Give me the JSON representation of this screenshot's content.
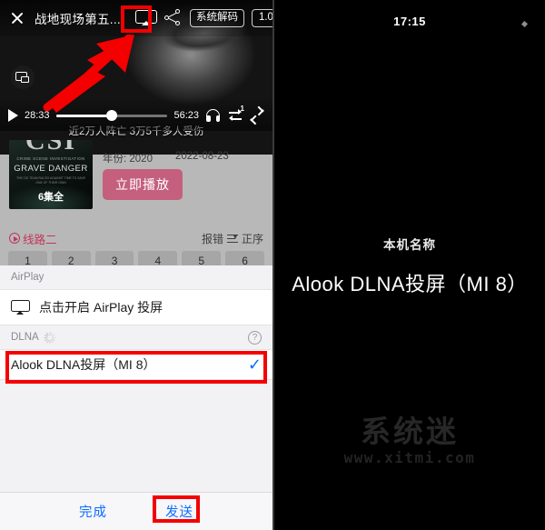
{
  "player": {
    "title": "战地现场第五...",
    "close_icon": "close-icon",
    "cast_icon": "cast-screen-icon",
    "share_icon": "share-icon",
    "decoder_label": "系统解码",
    "speed_label": "1.0",
    "pip_icon": "picture-in-picture-icon",
    "subtitle_text": "近2万人阵亡 3万5千多人受伤",
    "current_time": "28:33",
    "duration": "56:23",
    "play_icon": "play-icon",
    "headphone_icon": "headphone-icon",
    "repeat_icon": "repeat-one-icon",
    "fullscreen_icon": "fullscreen-expand-icon",
    "progress_percent": 50
  },
  "info": {
    "poster_title": "CSI",
    "poster_sub": "CRIME SCENE INVESTIGATION",
    "poster_name": "GRAVE DANGER",
    "poster_fine": "THE CSI TEAM RACES AGAINST TIME TO SAVE ONE OF THEIR OWN",
    "poster_badge": "6集全",
    "year": "年份: 2020",
    "date": "2022-08-23",
    "play_now_label": "立即播放"
  },
  "source": {
    "name": "线路二",
    "play_circle_icon": "play-circle-icon",
    "report_label": "报错",
    "sort_icon": "sort-icon",
    "order_label": "正序",
    "episodes": [
      "1",
      "2",
      "3",
      "4",
      "5",
      "6"
    ]
  },
  "airplay": {
    "section_label": "AirPlay",
    "row_icon": "airplay-screen-icon",
    "row_label": "点击开启 AirPlay 投屏"
  },
  "dlna": {
    "section_label": "DLNA",
    "spinner_icon": "loading-spinner-icon",
    "help_icon": "help-question-icon",
    "help_glyph": "?",
    "device_label": "Alook DLNA投屏（MI 8）",
    "selected_icon": "checkmark-icon",
    "selected_glyph": "✓"
  },
  "footer": {
    "done_label": "完成",
    "send_label": "发送"
  },
  "tv": {
    "time": "17:15",
    "heading": "本机名称",
    "device_name": "Alook DLNA投屏（MI 8）",
    "watermark_cn": "系统迷",
    "watermark_url": "www.xitmi.com"
  },
  "colors": {
    "accent_blue": "#0a6cff",
    "accent_pink": "#c2355c",
    "annotation_red": "#f40000",
    "play_button": "#c4607d"
  }
}
